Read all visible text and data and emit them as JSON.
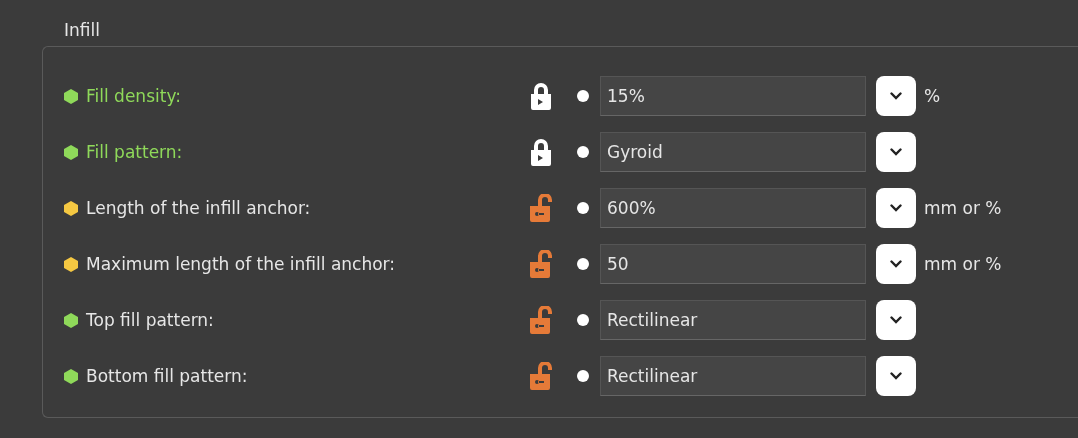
{
  "section": {
    "title": "Infill"
  },
  "options": [
    {
      "label": "Fill density:",
      "color": "#8fd95a",
      "locked": true,
      "value": "15%",
      "unit": "%"
    },
    {
      "label": "Fill pattern:",
      "color": "#8fd95a",
      "locked": true,
      "value": "Gyroid"
    },
    {
      "label": "Length of the infill anchor:",
      "color": "#f5c842",
      "locked": false,
      "value": "600%",
      "unit": "mm or %"
    },
    {
      "label": "Maximum length of the infill anchor:",
      "color": "#f5c842",
      "locked": false,
      "value": "50",
      "unit": "mm or %"
    },
    {
      "label": "Top fill pattern:",
      "color": "#8fd95a",
      "locked": false,
      "value": "Rectilinear"
    },
    {
      "label": "Bottom fill pattern:",
      "color": "#8fd95a",
      "locked": false,
      "value": "Rectilinear"
    }
  ]
}
